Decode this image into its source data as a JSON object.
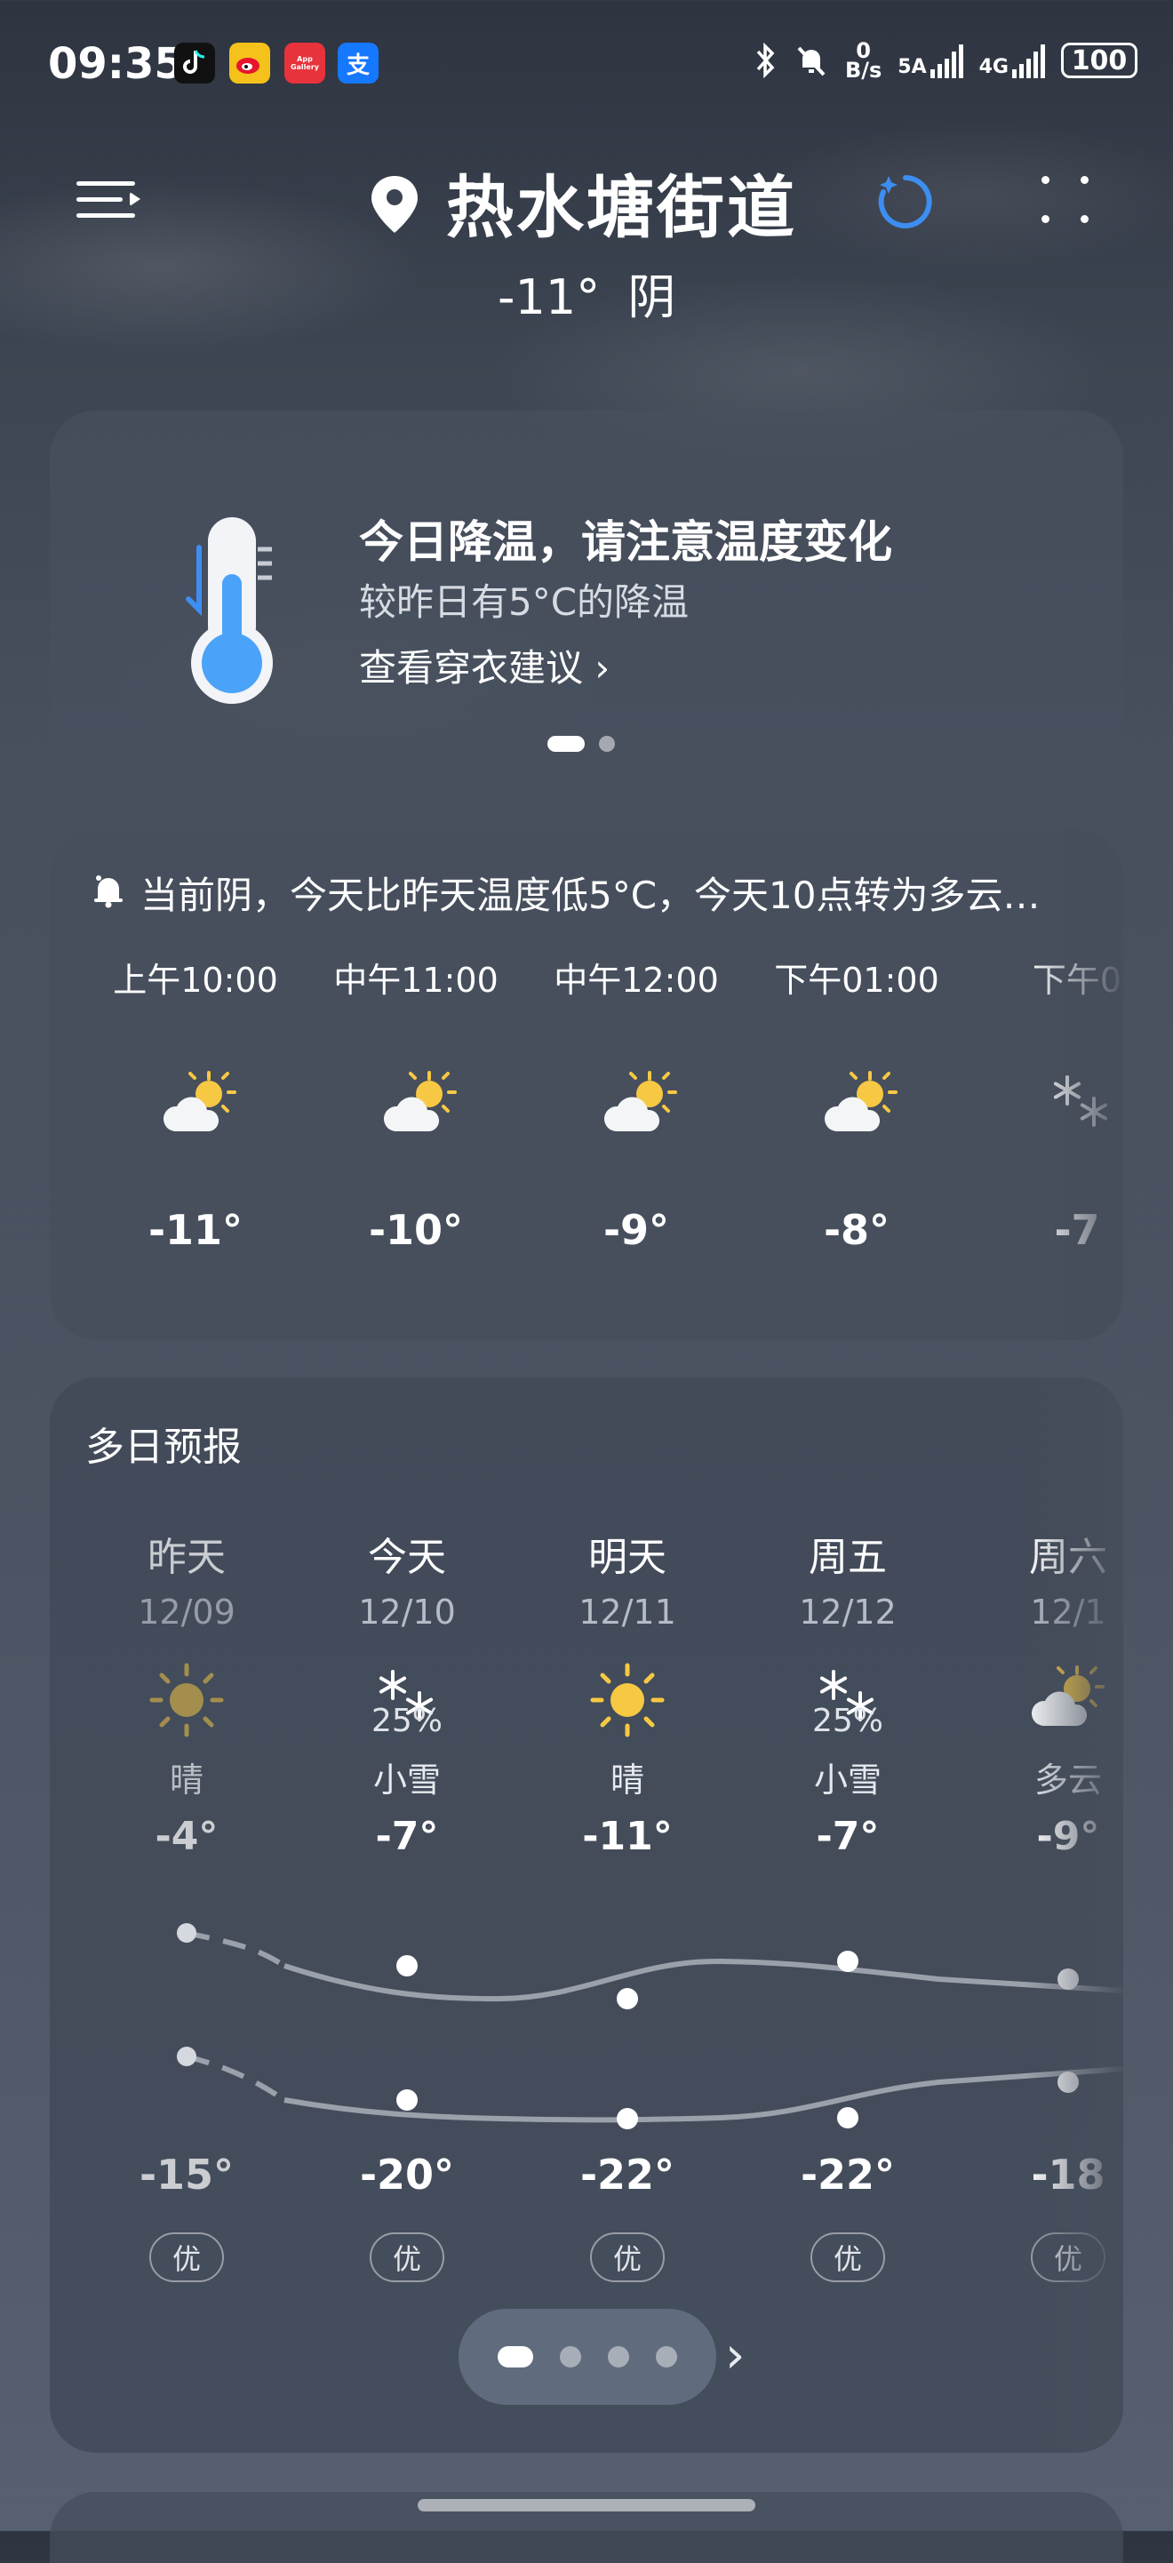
{
  "status_bar": {
    "time": "09:35",
    "apps": [
      "douyin-icon",
      "weibo-icon",
      "app-gallery-icon",
      "alipay-icon"
    ],
    "app_gallery_text": "App Gallery",
    "alipay_text": "支",
    "net_speed_value": "0",
    "net_speed_unit": "B/s",
    "network_5a": "5A",
    "network_4g": "4G",
    "battery": "100"
  },
  "header": {
    "location": "热水塘街道",
    "current_temp": "-11°",
    "current_condition": "阴"
  },
  "alert_card": {
    "title": "今日降温，请注意温度变化",
    "subtitle": "较昨日有5°C的降温",
    "link": "查看穿衣建议 ›"
  },
  "hourly": {
    "message": "当前阴，今天比昨天温度低5°C，今天10点转为多云…",
    "hours": [
      {
        "label": "上午10:00",
        "icon": "partly-cloudy-icon",
        "temp": "-11°"
      },
      {
        "label": "中午11:00",
        "icon": "partly-cloudy-icon",
        "temp": "-10°"
      },
      {
        "label": "中午12:00",
        "icon": "partly-cloudy-icon",
        "temp": "-9°"
      },
      {
        "label": "下午01:00",
        "icon": "partly-cloudy-icon",
        "temp": "-8°"
      },
      {
        "label": "下午0",
        "icon": "snow-icon",
        "temp": "-7"
      }
    ]
  },
  "daily": {
    "title": "多日预报",
    "days": [
      {
        "name": "昨天",
        "date": "12/09",
        "icon": "sun-icon",
        "pct": "",
        "cond": "晴",
        "hi": "-4°",
        "lo": "-15°",
        "aqi": "优"
      },
      {
        "name": "今天",
        "date": "12/10",
        "icon": "snow-icon",
        "pct": "25%",
        "cond": "小雪",
        "hi": "-7°",
        "lo": "-20°",
        "aqi": "优"
      },
      {
        "name": "明天",
        "date": "12/11",
        "icon": "sun-icon",
        "pct": "",
        "cond": "晴",
        "hi": "-11°",
        "lo": "-22°",
        "aqi": "优"
      },
      {
        "name": "周五",
        "date": "12/12",
        "icon": "snow-icon",
        "pct": "25%",
        "cond": "小雪",
        "hi": "-7°",
        "lo": "-22°",
        "aqi": "优"
      },
      {
        "name": "周六",
        "date": "12/1",
        "icon": "partly-cloudy-icon",
        "pct": "",
        "cond": "多云",
        "hi": "-9°",
        "lo": "-18",
        "aqi": "优"
      }
    ],
    "pager_glyph": "›"
  },
  "colors": {
    "sun": "#f7c843",
    "sun_yesterday": "#c8a84a",
    "accent_blue": "#3d8ef0"
  }
}
